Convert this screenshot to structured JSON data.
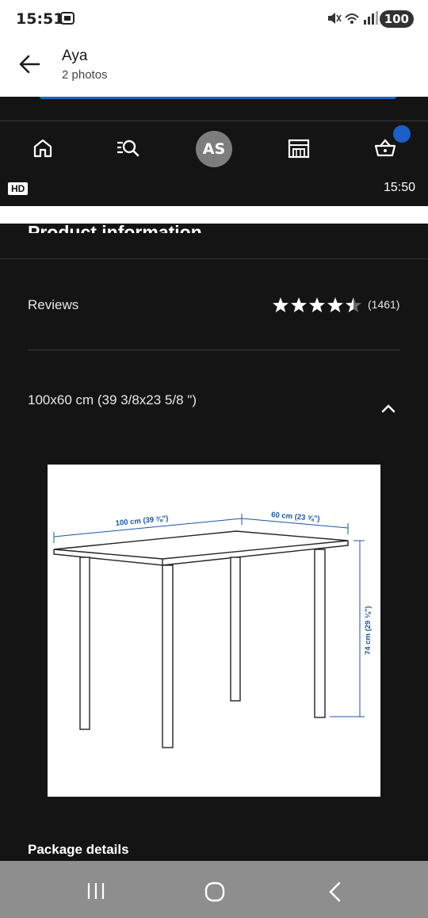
{
  "status_bar": {
    "time": "15:51",
    "battery": "100"
  },
  "gallery_header": {
    "title": "Aya",
    "subtitle": "2 photos"
  },
  "screenshot": {
    "nav": {
      "avatar_initials": "AS",
      "icons": [
        "home-icon",
        "search-list-icon",
        "store-icon",
        "cart-icon"
      ]
    },
    "video": {
      "hd_badge": "HD",
      "timestamp": "15:50"
    },
    "heading_cut": "Product information",
    "reviews": {
      "label": "Reviews",
      "rating": 4.5,
      "count": "(1461)"
    },
    "size_option": "100x60 cm (39 3/8x23 5/8 \")",
    "dimensions": {
      "width": "100 cm (39 ⅜\")",
      "depth": "60 cm (23 ⅝\")",
      "height": "74 cm (29 ⅛\")"
    },
    "package_details": "Package details"
  },
  "colors": {
    "accent_blue": "#1b5fc8",
    "diagram_blue": "#1a56a8",
    "dark_bg": "#141414"
  }
}
